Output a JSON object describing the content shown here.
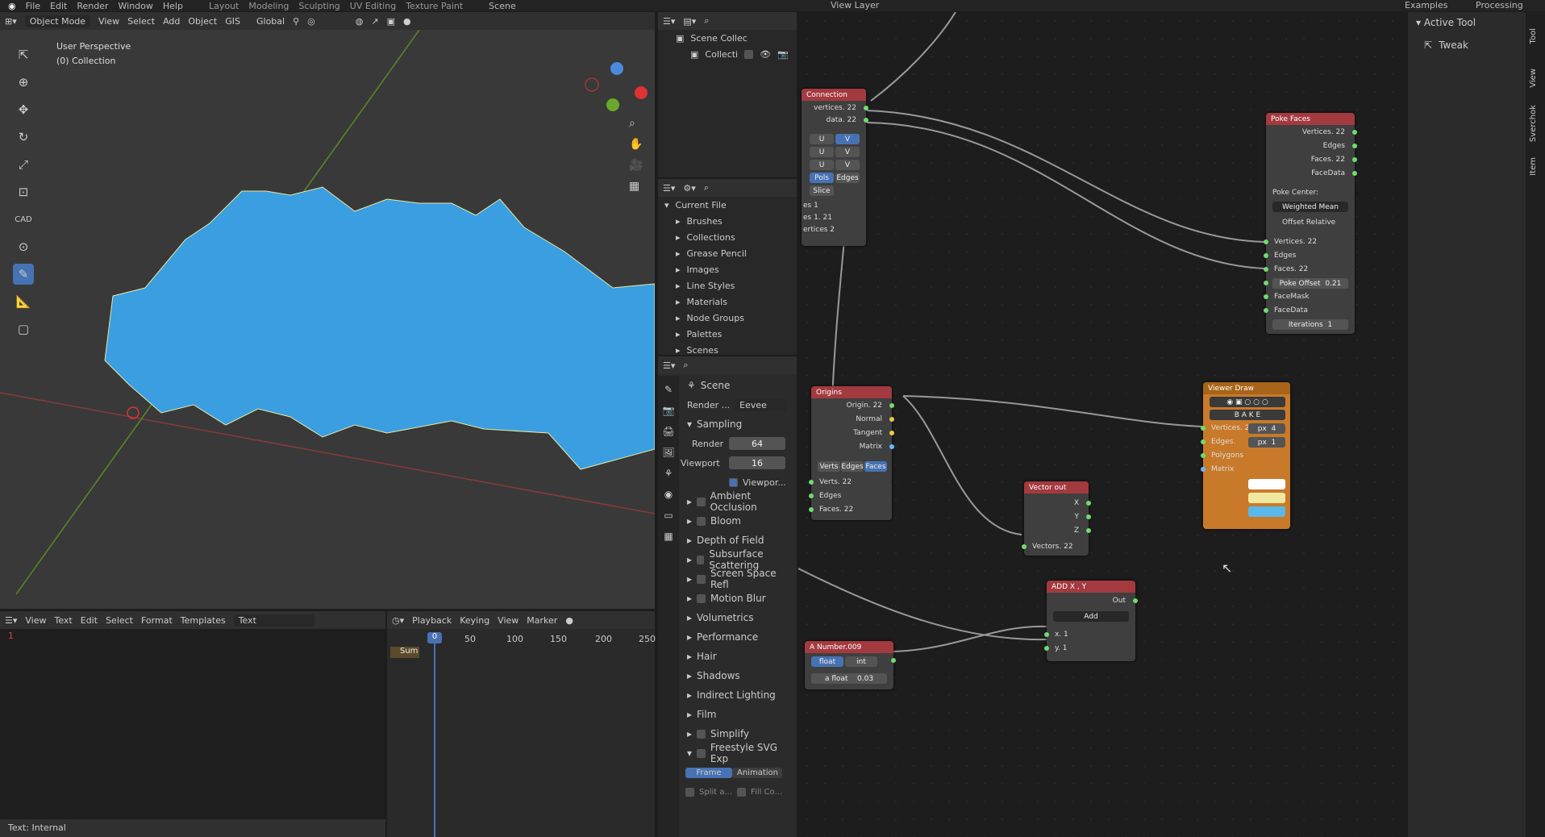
{
  "topbar": {
    "menus": [
      "File",
      "Edit",
      "Render",
      "Window",
      "Help"
    ],
    "workspaces": [
      "Layout",
      "Modeling",
      "Sculpting",
      "UV Editing",
      "Texture Paint"
    ],
    "scene": "Scene",
    "view_layer": "View Layer",
    "right": [
      "Examples",
      "Processing"
    ]
  },
  "viewport": {
    "mode": "Object Mode",
    "menus": [
      "View",
      "Select",
      "Add",
      "Object",
      "GIS"
    ],
    "orientation": "Global",
    "title": "User Perspective",
    "subtitle": "(0) Collection",
    "cad_label": "CAD"
  },
  "text_editor": {
    "menus": [
      "View",
      "Text",
      "Edit",
      "Select",
      "Format",
      "Templates"
    ],
    "name": "Text",
    "line_number": "1",
    "status": "Text: Internal"
  },
  "timeline": {
    "menus": [
      "Playback",
      "Keying",
      "View",
      "Marker"
    ],
    "frame": "0",
    "ticks": [
      "50",
      "100",
      "150",
      "200",
      "250"
    ],
    "summary": "Sum"
  },
  "outliner": {
    "scene_collection": "Scene Collec",
    "collection": "Collecti"
  },
  "file_browser": {
    "root": "Current File",
    "items": [
      "Brushes",
      "Collections",
      "Grease Pencil",
      "Images",
      "Line Styles",
      "Materials",
      "Node Groups",
      "Palettes",
      "Scenes"
    ]
  },
  "properties": {
    "scene": "Scene",
    "render_label": "Render ...",
    "engine": "Eevee",
    "sampling": "Sampling",
    "render_samples_label": "Render",
    "render_samples": "64",
    "viewport_samples_label": "Viewport",
    "viewport_samples": "16",
    "viewport_denoise": "Viewpor...",
    "panels": [
      "Ambient Occlusion",
      "Bloom",
      "Depth of Field",
      "Subsurface Scattering",
      "Screen Space Refl",
      "Motion Blur",
      "Volumetrics",
      "Performance",
      "Hair",
      "Shadows",
      "Indirect Lighting",
      "Film",
      "Simplify",
      "Freestyle SVG Exp"
    ],
    "frame_btn": "Frame",
    "animation_btn": "Animation",
    "split": "Split a...",
    "fill": "Fill Co..."
  },
  "side_panel": {
    "active_tool": "Active Tool",
    "tweak": "Tweak",
    "tabs": [
      "Tool",
      "View",
      "Sverchok",
      "Item"
    ]
  },
  "nodes": {
    "connection": {
      "title": "Connection",
      "out1": "vertices. 22",
      "out2": "data. 22",
      "btns": [
        [
          "U",
          "V"
        ],
        [
          "U",
          "V"
        ],
        [
          "U",
          "V"
        ]
      ],
      "pols": "Pols",
      "edges": "Edges",
      "slice": "Slice",
      "r1": "es 1",
      "r2": "es 1. 21",
      "r3": "ertices 2"
    },
    "poke": {
      "title": "Poke Faces",
      "outs": [
        "Vertices. 22",
        "Edges",
        "Faces. 22",
        "FaceData"
      ],
      "center_label": "Poke Center:",
      "center": "Weighted Mean",
      "offset_rel": "Offset Relative",
      "ins": [
        "Vertices. 22",
        "Edges",
        "Faces. 22"
      ],
      "poke_offset_label": "Poke Offset",
      "poke_offset": "0.21",
      "ins2": [
        "FaceMask",
        "FaceData"
      ],
      "iter_label": "Iterations",
      "iter": "1"
    },
    "origins": {
      "title": "Origins",
      "outs": [
        "Origin. 22",
        "Normal",
        "Tangent",
        "Matrix"
      ],
      "modes": [
        "Verts",
        "Edges",
        "Faces"
      ],
      "ins": [
        "Verts. 22",
        "Edges",
        "Faces. 22"
      ]
    },
    "viewer": {
      "title": "Viewer Draw",
      "bake": "B A K E",
      "ins": [
        "Vertices. 22",
        "Edges.",
        "Polygons",
        "Matrix"
      ],
      "px1": "px",
      "v1": "4",
      "px2": "px",
      "v2": "1"
    },
    "vector_out": {
      "title": "Vector out",
      "outs": [
        "X",
        "Y",
        "Z"
      ],
      "ins": [
        "Vectors. 22"
      ]
    },
    "add": {
      "title": "ADD X , Y",
      "out": "Out",
      "op": "Add",
      "ins": [
        "x. 1",
        "y. 1"
      ]
    },
    "number": {
      "title": "A Number.009",
      "float": "float",
      "int": "int",
      "field": "a float",
      "value": "0.03"
    }
  },
  "colors": {
    "accent": "#4772b3",
    "mesh": "#3a9ee0",
    "node_red": "#a33a3f",
    "node_orange": "#c87a2a"
  }
}
